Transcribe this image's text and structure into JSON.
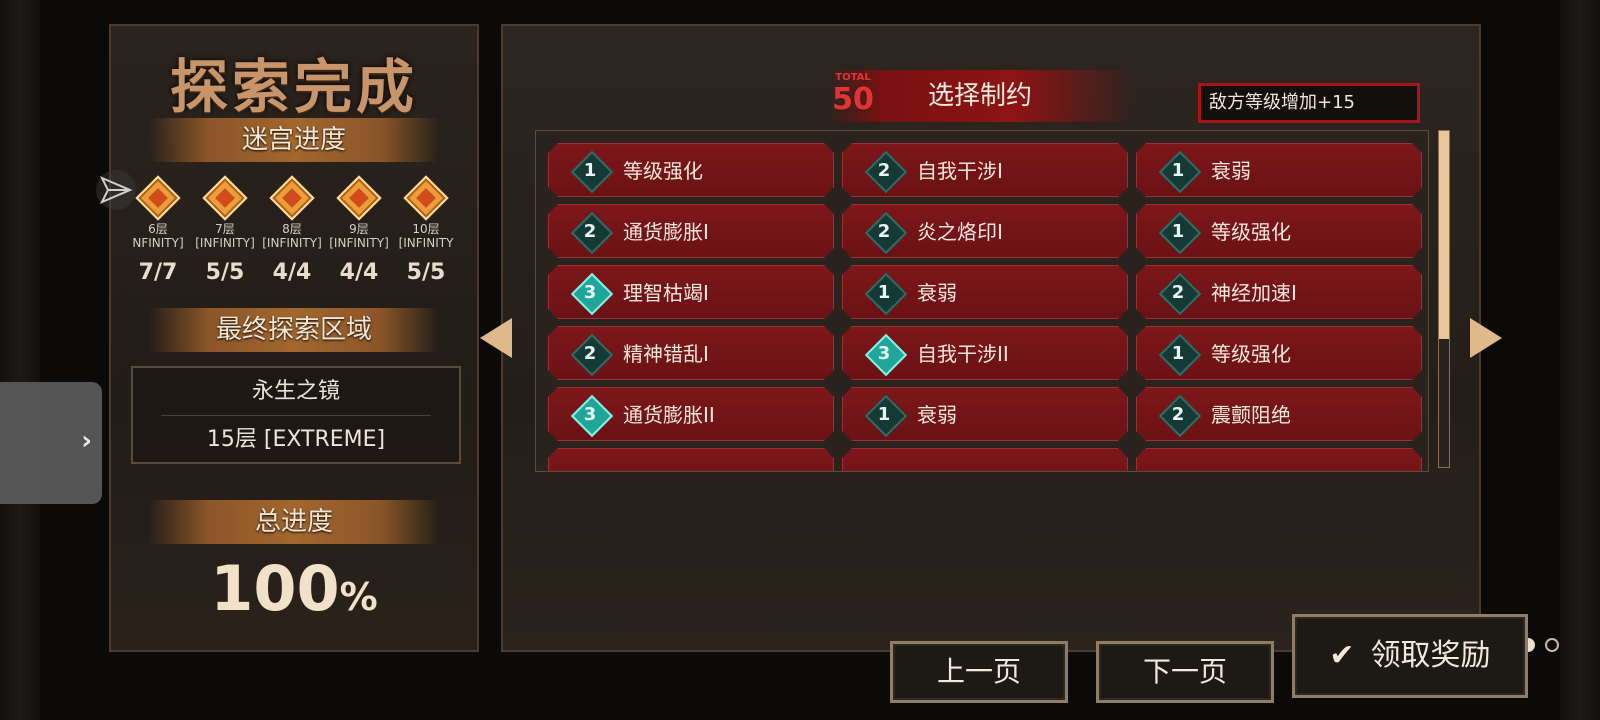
{
  "left": {
    "title": "探索完成",
    "maze_progress_label": "迷宫进度",
    "floors": [
      {
        "floor": "6层",
        "mode": "NFINITY]",
        "count": "7/7"
      },
      {
        "floor": "7层",
        "mode": "[INFINITY]",
        "count": "5/5"
      },
      {
        "floor": "8层",
        "mode": "[INFINITY]",
        "count": "4/4"
      },
      {
        "floor": "9层",
        "mode": "[INFINITY]",
        "count": "4/4"
      },
      {
        "floor": "10层",
        "mode": "[INFINITY",
        "count": "5/5"
      }
    ],
    "final_area_label": "最终探索区域",
    "final_area_name": "永生之镜",
    "final_area_floor": "15层 [EXTREME]",
    "total_progress_label": "总进度",
    "total_progress_value": "100",
    "total_progress_unit": "%"
  },
  "right": {
    "total_label": "TOTAL",
    "total_value": "50",
    "header_title": "选择制约",
    "summary_text": "敌方等级增加+15",
    "constraints": [
      {
        "level": "1",
        "label": "等级强化"
      },
      {
        "level": "2",
        "label": "自我干涉I"
      },
      {
        "level": "1",
        "label": "衰弱"
      },
      {
        "level": "2",
        "label": "通货膨胀I"
      },
      {
        "level": "2",
        "label": "炎之烙印I"
      },
      {
        "level": "1",
        "label": "等级强化"
      },
      {
        "level": "3",
        "label": "理智枯竭I"
      },
      {
        "level": "1",
        "label": "衰弱"
      },
      {
        "level": "2",
        "label": "神经加速I"
      },
      {
        "level": "2",
        "label": "精神错乱I"
      },
      {
        "level": "3",
        "label": "自我干涉II"
      },
      {
        "level": "1",
        "label": "等级强化"
      },
      {
        "level": "3",
        "label": "通货膨胀II"
      },
      {
        "level": "1",
        "label": "衰弱"
      },
      {
        "level": "2",
        "label": "震颤阻绝"
      }
    ],
    "page_dots": {
      "total": 6,
      "active_index": 4
    },
    "scroll_position": 0.62
  },
  "buttons": {
    "prev": "上一页",
    "next": "下一页",
    "claim": "领取奖励",
    "claim_icon": "check-icon"
  },
  "side_tab_icon": "chevron-right-icon",
  "colors": {
    "accent_red": "#7d171a",
    "summary_border": "#a8141a",
    "gold": "#c8946a",
    "badge_teal": "#1fa699"
  }
}
